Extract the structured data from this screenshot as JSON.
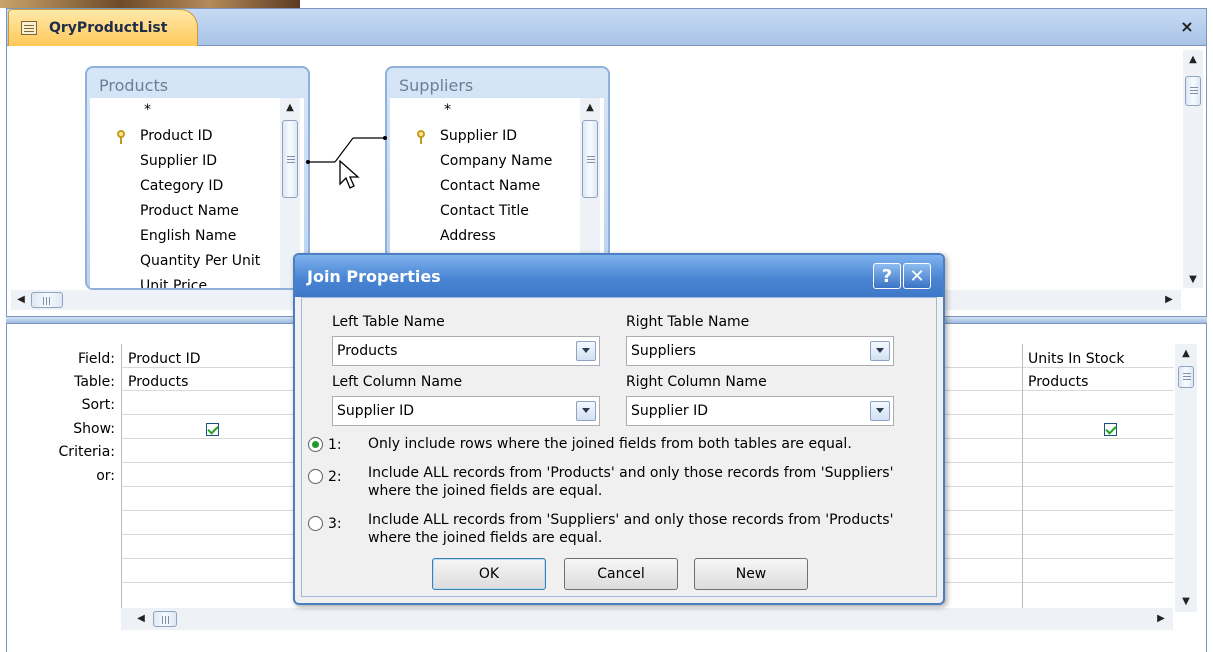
{
  "document_tab": {
    "label": "QryProductList",
    "close_glyph": "×"
  },
  "tables": {
    "products": {
      "title": "Products",
      "fields": [
        "*",
        "Product ID",
        "Supplier ID",
        "Category ID",
        "Product Name",
        "English Name",
        "Quantity Per Unit",
        "Unit Price"
      ],
      "primary_key": "Product ID"
    },
    "suppliers": {
      "title": "Suppliers",
      "fields": [
        "*",
        "Supplier ID",
        "Company Name",
        "Contact Name",
        "Contact Title",
        "Address"
      ],
      "primary_key": "Supplier ID"
    }
  },
  "grid": {
    "row_labels": {
      "field": "Field:",
      "table": "Table:",
      "sort": "Sort:",
      "show": "Show:",
      "criteria": "Criteria:",
      "or": "or:"
    },
    "columns": [
      {
        "field": "Product ID",
        "table": "Products",
        "show": true
      },
      {
        "field": "Units In Stock",
        "table": "Products",
        "show": true
      }
    ]
  },
  "dialog": {
    "title": "Join Properties",
    "help_glyph": "?",
    "close_glyph": "✕",
    "left_table_label": "Left Table Name",
    "left_table_value": "Products",
    "right_table_label": "Right Table Name",
    "right_table_value": "Suppliers",
    "left_column_label": "Left Column Name",
    "left_column_value": "Supplier ID",
    "right_column_label": "Right Column Name",
    "right_column_value": "Supplier ID",
    "options": [
      {
        "number": "1:",
        "line1": "Only include rows where the joined fields from both tables are equal.",
        "line2": "",
        "selected": true
      },
      {
        "number": "2:",
        "line1": "Include ALL records from 'Products' and only those records from 'Suppliers'",
        "line2": "where the joined fields are equal.",
        "selected": false
      },
      {
        "number": "3:",
        "line1": "Include ALL records from 'Suppliers' and only those records from 'Products'",
        "line2": "where the joined fields are equal.",
        "selected": false
      }
    ],
    "buttons": {
      "ok": "OK",
      "cancel": "Cancel",
      "new": "New"
    }
  },
  "colors": {
    "accent": "#4a86d4",
    "tab": "#ffc85a",
    "check": "#21a121"
  }
}
